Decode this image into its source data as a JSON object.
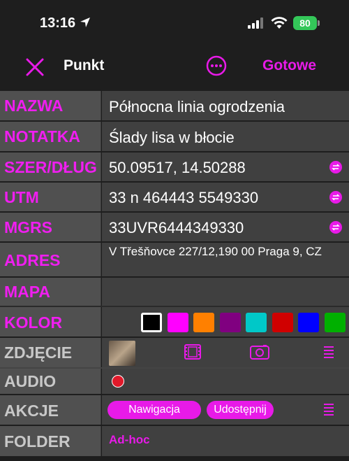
{
  "status_bar": {
    "time": "13:16",
    "battery": "80"
  },
  "navbar": {
    "title": "Punkt",
    "done_label": "Gotowe"
  },
  "fields": {
    "name": {
      "label": "NAZWA",
      "value": "Północna linia ogrodzenia"
    },
    "note": {
      "label": "NOTATKA",
      "value": "Ślady lisa w błocie"
    },
    "latlon": {
      "label": "SZER/DŁUG",
      "value": "50.09517, 14.50288"
    },
    "utm": {
      "label": "UTM",
      "value": "33 n 464443 5549330"
    },
    "mgrs": {
      "label": "MGRS",
      "value": "33UVR6444349330"
    },
    "address": {
      "label": "ADRES",
      "value": "V Třešňovce 227/12,190 00 Praga 9, CZ"
    },
    "map": {
      "label": "MAPA"
    },
    "color": {
      "label": "KOLOR",
      "swatches": [
        "#000000",
        "#ff00ff",
        "#ff8000",
        "#800080",
        "#00c8c8",
        "#d00000",
        "#0000ff",
        "#00b000"
      ],
      "selected_index": 0
    },
    "photo": {
      "label": "ZDJĘCIE"
    },
    "audio": {
      "label": "AUDIO"
    },
    "actions": {
      "label": "AKCJE",
      "navigate_label": "Nawigacja",
      "share_label": "Udostępnij"
    },
    "folder": {
      "label": "FOLDER",
      "value": "Ad-hoc"
    }
  },
  "colors": {
    "accent": "#e81ae8",
    "label_bg": "#505050",
    "value_bg": "#404040"
  },
  "icons": [
    "location-arrow-icon",
    "signal-icon",
    "wifi-icon",
    "battery-icon",
    "close-icon",
    "more-icon",
    "swap-icon",
    "film-icon",
    "camera-icon",
    "menu-icon"
  ]
}
